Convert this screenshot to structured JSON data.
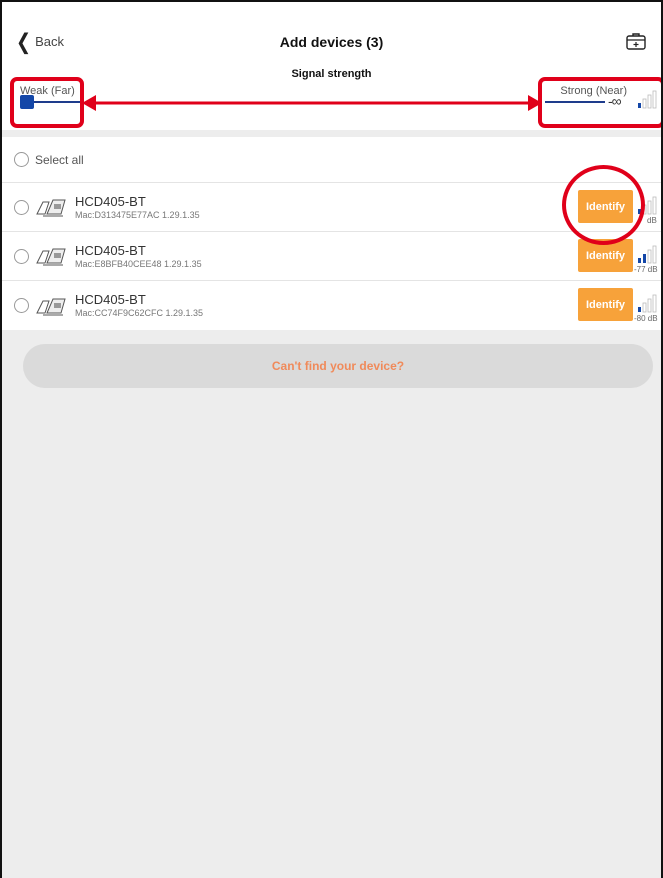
{
  "header": {
    "back_label": "Back",
    "title": "Add devices (3)",
    "toolbox_icon": "toolbox-icon"
  },
  "signal": {
    "title": "Signal strength",
    "weak_label": "Weak (Far)",
    "strong_label": "Strong (Near)",
    "value": "-∞"
  },
  "list": {
    "select_all_label": "Select all",
    "devices": [
      {
        "name": "HCD405-BT",
        "mac": "Mac:D313475E77AC 1.29.1.35",
        "identify_label": "Identify",
        "db": "dB"
      },
      {
        "name": "HCD405-BT",
        "mac": "Mac:E8BFB40CEE48 1.29.1.35",
        "identify_label": "Identify",
        "db": "-77 dB"
      },
      {
        "name": "HCD405-BT",
        "mac": "Mac:CC74F9C62CFC 1.29.1.35",
        "identify_label": "Identify",
        "db": "-80 dB"
      }
    ]
  },
  "cant_find_label": "Can't find your device?",
  "colors": {
    "accent": "#f7a23a",
    "annotation": "#e0001a",
    "slider": "#1447a8",
    "cant_find_text": "#f08a5a"
  }
}
